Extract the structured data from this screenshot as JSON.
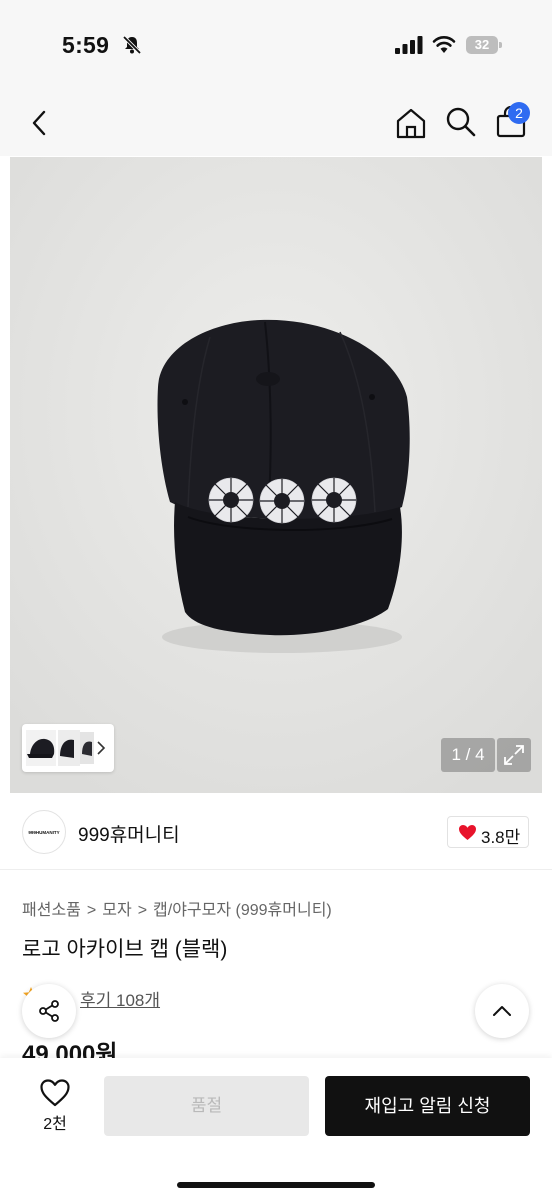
{
  "status_bar": {
    "time": "5:59",
    "battery": "32"
  },
  "nav": {
    "cart_badge": "2"
  },
  "gallery": {
    "counter": "1 / 4"
  },
  "brand": {
    "logo_text": "999HUMANITY",
    "name": "999휴머니티",
    "likes": "3.8만"
  },
  "product": {
    "breadcrumb": [
      "패션소품",
      "모자",
      "캡/야구모자 (999휴머니티)"
    ],
    "title": "로고 아카이브 캡 (블랙)",
    "reviews": "후기 108개",
    "price": "49,000원"
  },
  "bottom_bar": {
    "wish_count": "2천",
    "soldout_label": "품절",
    "restock_label": "재입고 알림 신청"
  },
  "colors": {
    "accent_badge": "#2f6bf1",
    "heart": "#e8132b",
    "primary_button": "#111111",
    "disabled_button": "#e8e8e8"
  }
}
